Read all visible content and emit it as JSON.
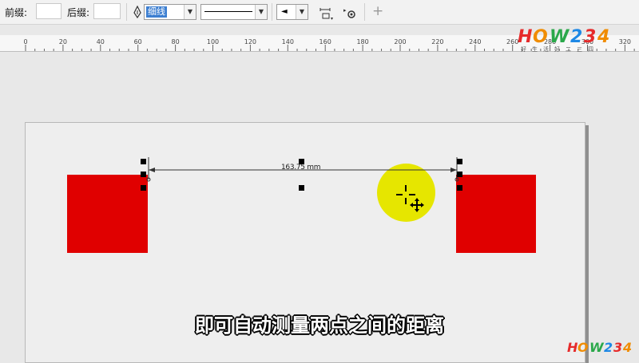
{
  "toolbar": {
    "prefix_label": "前缀:",
    "suffix_label": "后缀:",
    "prefix_value": "",
    "suffix_value": "",
    "line_style_value": "细线",
    "icons": [
      "pen-icon",
      "line-style-preview",
      "arrow-end-icon",
      "text-position-icon",
      "dynamic-dimension-icon",
      "add-icon"
    ]
  },
  "ruler": {
    "labels": [
      "0",
      "20",
      "40",
      "60",
      "80",
      "100",
      "120",
      "140",
      "160",
      "180",
      "200",
      "220",
      "240",
      "260",
      "280",
      "300",
      "320"
    ]
  },
  "canvas": {
    "dimension_text": "163.75 mm",
    "shape_color": "#e00000",
    "cursor_highlight_color": "#e6e600"
  },
  "caption": "即可自动测量两点之间的距离",
  "logo": {
    "brand": "HOW234",
    "slogan": "好 生 活 好 二 三 四",
    "colors": [
      "#e62a2a",
      "#f08c00",
      "#2aa84a",
      "#1e88e5"
    ]
  }
}
